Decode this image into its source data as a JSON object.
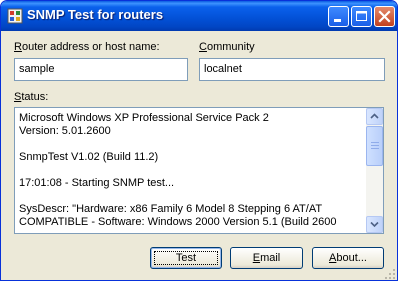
{
  "window": {
    "title": "SNMP Test for routers",
    "icon": "network-icon",
    "controls": [
      "minimize",
      "maximize",
      "close"
    ]
  },
  "router_field": {
    "label_prefix": "",
    "label_hotkey": "R",
    "label_rest": "outer address or host name:",
    "value": "sample"
  },
  "community_field": {
    "label_prefix": "",
    "label_hotkey": "C",
    "label_rest": "ommunity",
    "value": "localnet"
  },
  "status": {
    "label_prefix": "",
    "label_hotkey": "S",
    "label_rest": "tatus:",
    "lines": [
      "Microsoft Windows XP Professional Service Pack 2",
      "Version: 5.01.2600",
      "",
      "SnmpTest V1.02 (Build 11.2)",
      "",
      "17:01:08 - Starting SNMP test...",
      "",
      "SysDescr: \"Hardware: x86 Family 6 Model 8 Stepping 6 AT/AT",
      "COMPATIBLE - Software: Windows 2000 Version 5.1 (Build 2600"
    ]
  },
  "buttons": {
    "test": {
      "label": "Test"
    },
    "email": {
      "label_prefix": "",
      "label_hotkey": "E",
      "label_rest": "mail"
    },
    "about": {
      "label_prefix": "",
      "label_hotkey": "A",
      "label_rest": "bout..."
    }
  },
  "colors": {
    "titlebar": "#0a61ec",
    "window_bg": "#ece9d8",
    "input_border": "#7f9db9",
    "close_button": "#c2411f"
  }
}
